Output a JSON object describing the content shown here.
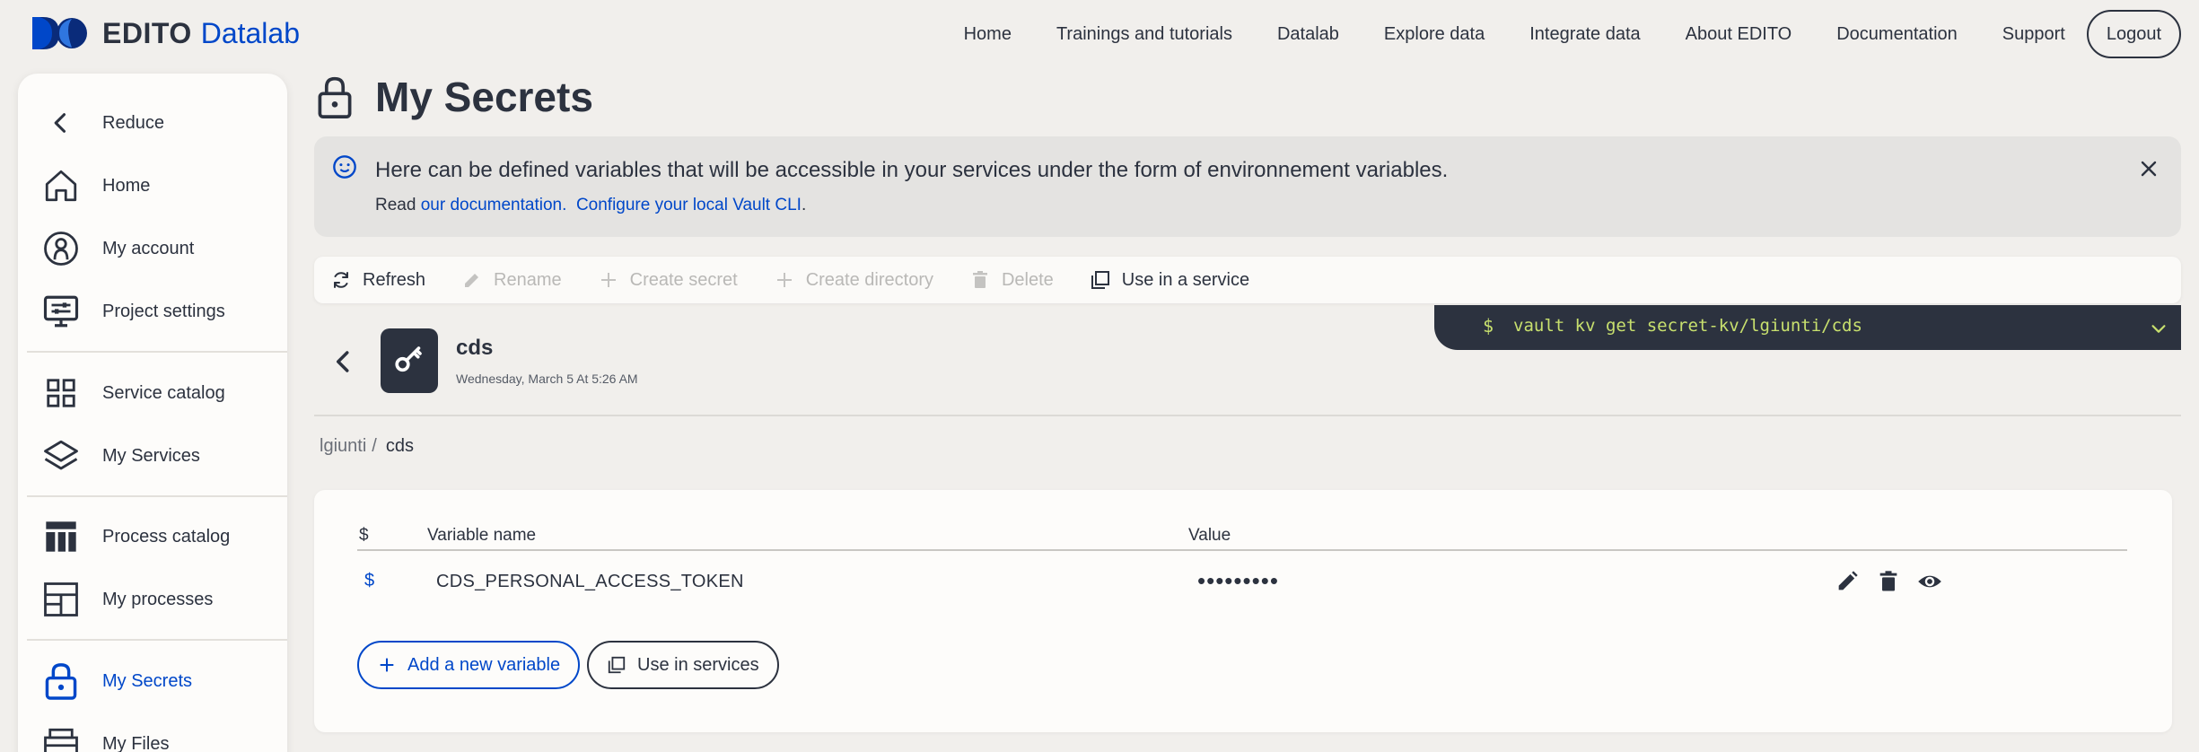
{
  "brand": {
    "name": "EDITO",
    "sub": "Datalab"
  },
  "topnav": {
    "items": [
      "Home",
      "Trainings and tutorials",
      "Datalab",
      "Explore data",
      "Integrate data",
      "About EDITO",
      "Documentation",
      "Support"
    ],
    "logout": "Logout"
  },
  "sidebar": {
    "items": [
      {
        "label": "Reduce",
        "icon": "chevron-left-icon"
      },
      {
        "label": "Home",
        "icon": "home-icon"
      },
      {
        "label": "My account",
        "icon": "account-icon"
      },
      {
        "label": "Project settings",
        "icon": "settings-monitor-icon"
      },
      {
        "label": "Service catalog",
        "icon": "grid-icon"
      },
      {
        "label": "My Services",
        "icon": "layers-icon"
      },
      {
        "label": "Process catalog",
        "icon": "table-icon"
      },
      {
        "label": "My processes",
        "icon": "processes-icon"
      },
      {
        "label": "My Secrets",
        "icon": "lock-icon",
        "active": true
      },
      {
        "label": "My Files",
        "icon": "files-icon"
      }
    ]
  },
  "page": {
    "title": "My Secrets"
  },
  "banner": {
    "text": "Here can be defined variables that will be accessible in your services under the form of environnement variables.",
    "read_prefix": "Read",
    "link_docs": "our documentation.",
    "link_vault": "Configure your local Vault CLI",
    "link_suffix": "."
  },
  "toolbar": {
    "refresh": "Refresh",
    "rename": "Rename",
    "create_secret": "Create secret",
    "create_directory": "Create directory",
    "delete": "Delete",
    "use_in_service": "Use in a service"
  },
  "vault": {
    "prompt": "$",
    "command": "vault kv get secret-kv/lgiunti/cds"
  },
  "secret": {
    "name": "cds",
    "date": "Wednesday, March 5 At 5:26 AM"
  },
  "breadcrumb": {
    "parent": "lgiunti",
    "separator": "/",
    "current": "cds"
  },
  "table": {
    "headers": {
      "dollar": "$",
      "name": "Variable name",
      "value": "Value"
    },
    "rows": [
      {
        "dollar": "$",
        "name": "CDS_PERSONAL_ACCESS_TOKEN",
        "value": "•••••••••"
      }
    ],
    "add_variable": "Add a new variable",
    "use_in_services": "Use in services"
  },
  "colors": {
    "accent": "#0047c9",
    "dark": "#2c323f",
    "background": "#f1efec",
    "terminal_text": "#c8e06e"
  }
}
